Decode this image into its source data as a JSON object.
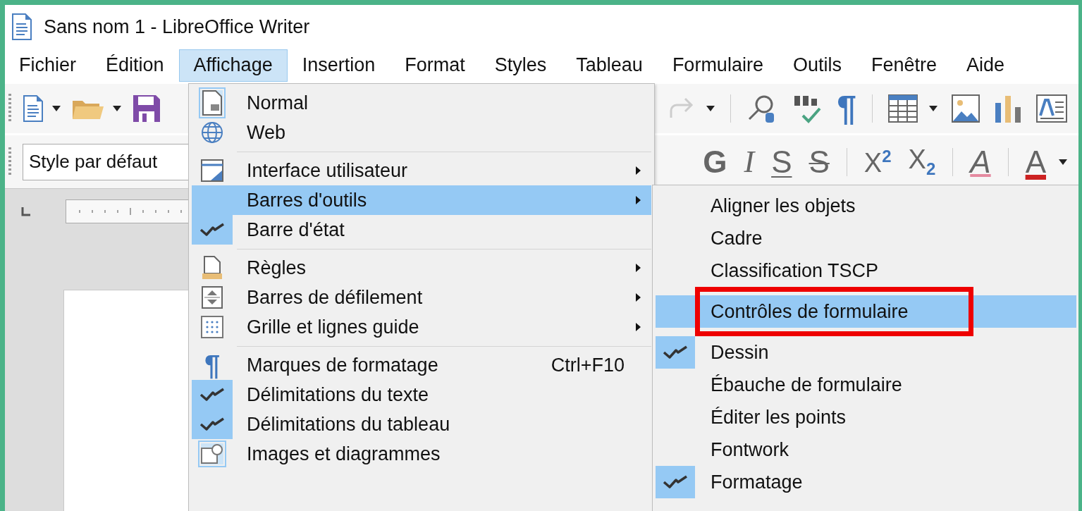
{
  "window": {
    "title": "Sans nom 1 - LibreOffice Writer"
  },
  "menubar": [
    {
      "label": "Fichier",
      "selected": false
    },
    {
      "label": "Édition",
      "selected": false
    },
    {
      "label": "Affichage",
      "selected": true
    },
    {
      "label": "Insertion",
      "selected": false
    },
    {
      "label": "Format",
      "selected": false
    },
    {
      "label": "Styles",
      "selected": false
    },
    {
      "label": "Tableau",
      "selected": false
    },
    {
      "label": "Formulaire",
      "selected": false
    },
    {
      "label": "Outils",
      "selected": false
    },
    {
      "label": "Fenêtre",
      "selected": false
    },
    {
      "label": "Aide",
      "selected": false
    }
  ],
  "toolbar_standard": {
    "left": [
      {
        "kind": "new",
        "dropdown": true
      },
      {
        "kind": "open",
        "dropdown": true
      },
      {
        "kind": "save"
      }
    ],
    "right": [
      {
        "kind": "redo",
        "dropdown": true,
        "disabled": true
      },
      {
        "kind": "separator"
      },
      {
        "kind": "find"
      },
      {
        "kind": "spelling"
      },
      {
        "kind": "marks",
        "glyph": "¶"
      },
      {
        "kind": "separator"
      },
      {
        "kind": "table",
        "dropdown": true
      },
      {
        "kind": "image"
      },
      {
        "kind": "chart"
      },
      {
        "kind": "textbox"
      }
    ]
  },
  "toolbar_formatting": {
    "style_box": {
      "value": "Style par défaut"
    },
    "buttons": [
      {
        "kind": "bold",
        "text": "G"
      },
      {
        "kind": "italic",
        "text": "I"
      },
      {
        "kind": "underline",
        "text": "S"
      },
      {
        "kind": "strike",
        "text": "S"
      },
      {
        "kind": "separator"
      },
      {
        "kind": "sup",
        "text": "X$^{2}$"
      },
      {
        "kind": "sub",
        "text": "X$_{2}$"
      },
      {
        "kind": "separator"
      },
      {
        "kind": "clear",
        "text": "A"
      },
      {
        "kind": "separator"
      },
      {
        "kind": "color",
        "text": "A",
        "dropdown": true
      }
    ]
  },
  "view_menu": {
    "groups": [
      [
        {
          "label": "Normal",
          "kind": "page",
          "checked": true,
          "submenu": false,
          "selected": false
        },
        {
          "label": "Web",
          "kind": "globe",
          "checked": false,
          "submenu": false,
          "selected": false
        }
      ],
      [
        {
          "label": "Interface utilisateur",
          "kind": "window",
          "checked": false,
          "submenu": true,
          "selected": false
        },
        {
          "label": "Barres d'outils",
          "kind": "none",
          "checked": false,
          "submenu": true,
          "selected": true
        },
        {
          "label": "Barre d'état",
          "kind": "none",
          "checked": true,
          "submenu": false,
          "selected": false
        }
      ],
      [
        {
          "label": "Règles",
          "kind": "ruler",
          "checked": false,
          "submenu": true,
          "selected": false
        },
        {
          "label": "Barres de défilement",
          "kind": "scroll",
          "checked": false,
          "submenu": true,
          "selected": false
        },
        {
          "label": "Grille et lignes guide",
          "kind": "grid",
          "checked": false,
          "submenu": true,
          "selected": false
        }
      ],
      [
        {
          "label": "Marques de formatage",
          "kind": "glyph",
          "glyph": "¶",
          "shortcut": "Ctrl+F10",
          "checked": false,
          "submenu": false,
          "selected": false
        },
        {
          "label": "Délimitations du texte",
          "kind": "none",
          "checked": true,
          "submenu": false,
          "selected": false
        },
        {
          "label": "Délimitations du tableau",
          "kind": "none",
          "checked": true,
          "submenu": false,
          "selected": false
        },
        {
          "label": "Images et diagrammes",
          "kind": "picture",
          "checked": true,
          "submenu": false,
          "selected": false
        }
      ]
    ]
  },
  "toolbars_submenu": {
    "items": [
      {
        "label": "Aligner les objets",
        "checked": false,
        "selected": false,
        "outlined": false
      },
      {
        "label": "Cadre",
        "checked": false,
        "selected": false,
        "outlined": false
      },
      {
        "label": "Classification TSCP",
        "checked": false,
        "selected": false,
        "outlined": false
      },
      {
        "label": "Contrôles de formulaire",
        "checked": false,
        "selected": true,
        "outlined": true
      },
      {
        "label": "Dessin",
        "checked": true,
        "selected": false,
        "outlined": false
      },
      {
        "label": "Ébauche de formulaire",
        "checked": false,
        "selected": false,
        "outlined": false
      },
      {
        "label": "Éditer les points",
        "checked": false,
        "selected": false,
        "outlined": false
      },
      {
        "label": "Fontwork",
        "checked": false,
        "selected": false,
        "outlined": false
      },
      {
        "label": "Formatage",
        "checked": true,
        "selected": false,
        "outlined": false
      }
    ]
  }
}
